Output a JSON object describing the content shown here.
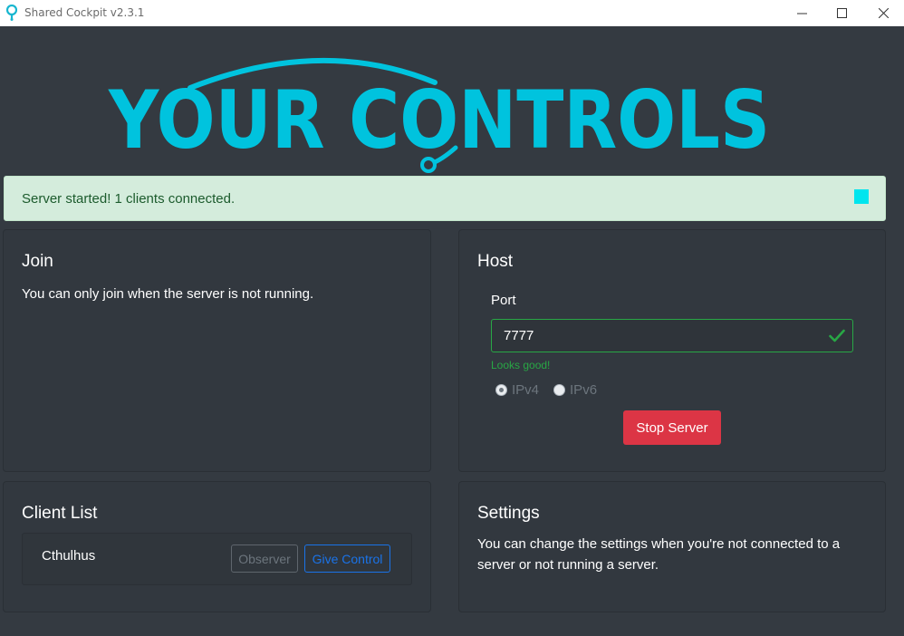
{
  "window": {
    "title": "Shared Cockpit v2.3.1",
    "icon": "map-pin-icon",
    "controls": [
      "minimize-icon",
      "maximize-icon",
      "close-icon"
    ]
  },
  "logo": {
    "text": "YOUR CONTROLS",
    "color": "#00c3de"
  },
  "alert": {
    "message": "Server started! 1 clients connected.",
    "icon": "stop-square-icon",
    "color": "#00e5ee"
  },
  "join": {
    "title": "Join",
    "message": "You can only join when the server is not running."
  },
  "host": {
    "title": "Host",
    "port_label": "Port",
    "port_value": "7777",
    "valid_icon": "checkmark-icon",
    "feedback": "Looks good!",
    "ip_options": [
      {
        "label": "IPv4",
        "checked": true
      },
      {
        "label": "IPv6",
        "checked": false
      }
    ],
    "stop_button": "Stop Server",
    "stop_color": "#dc3545"
  },
  "clients": {
    "title": "Client List",
    "items": [
      {
        "name": "Cthulhus",
        "observer_label": "Observer",
        "give_control_label": "Give Control"
      }
    ]
  },
  "settings": {
    "title": "Settings",
    "message": "You can change the settings when you're not connected to a server or not running a server."
  }
}
